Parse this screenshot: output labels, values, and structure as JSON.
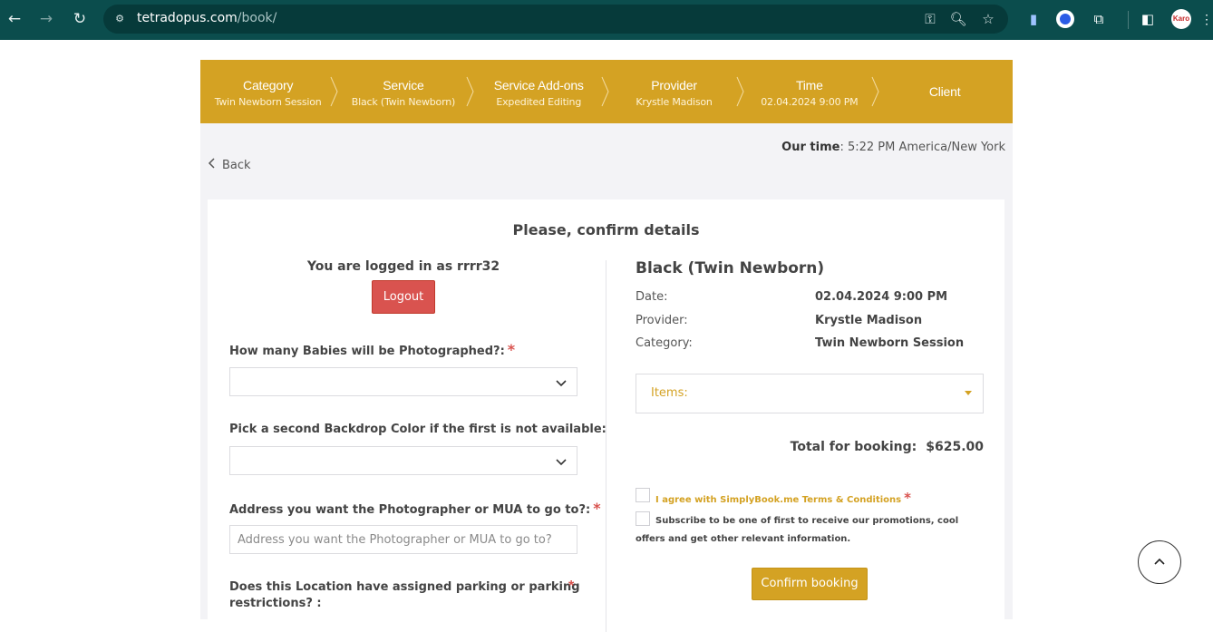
{
  "browser": {
    "url_domain": "tetradopus.com",
    "url_path": "/book/",
    "profile_label": "Karo"
  },
  "steps": [
    {
      "title": "Category",
      "sub": "Twin Newborn Session"
    },
    {
      "title": "Service",
      "sub": "Black (Twin Newborn)"
    },
    {
      "title": "Service Add-ons",
      "sub": "Expedited Editing"
    },
    {
      "title": "Provider",
      "sub": "Krystle Madison"
    },
    {
      "title": "Time",
      "sub": "02.04.2024 9:00 PM"
    },
    {
      "title": "Client",
      "sub": ""
    }
  ],
  "our_time": {
    "label": "Our time",
    "value": ": 5:22 PM America/New York"
  },
  "back_label": "Back",
  "card_title": "Please, confirm details",
  "login": {
    "text": "You are logged in as rrrr32",
    "logout_label": "Logout"
  },
  "questions": {
    "babies": {
      "label": "How many Babies will be Photographed?:",
      "required": "*",
      "value": ""
    },
    "backdrop": {
      "label": "Pick a second Backdrop Color if the first is not available:",
      "value": ""
    },
    "address": {
      "label": "Address you want the Photographer or MUA to go to?:",
      "required": "*",
      "placeholder": "Address you want the Photographer or MUA to go to?"
    },
    "parking": {
      "label_line1": "Does this Location have assigned parking or parking",
      "label_line2": "restrictions? :",
      "required": "*"
    }
  },
  "summary": {
    "service_name": "Black (Twin Newborn)",
    "rows": [
      {
        "label": "Date:",
        "value": "02.04.2024 9:00 PM"
      },
      {
        "label": "Provider:",
        "value": "Krystle Madison"
      },
      {
        "label": "Category:",
        "value": "Twin Newborn Session"
      }
    ],
    "items_label": "Items:",
    "total_label": "Total for booking:",
    "total_value": "$625.00",
    "terms_label": "I agree with SimplyBook.me Terms & Conditions",
    "terms_required": "*",
    "subscribe_label": "Subscribe to be one of first to receive our promotions, cool offers and get other relevant information.",
    "confirm_label": "Confirm booking"
  },
  "colors": {
    "accent": "#d4a223",
    "danger": "#d9534f",
    "chrome": "#0b4d4d"
  }
}
